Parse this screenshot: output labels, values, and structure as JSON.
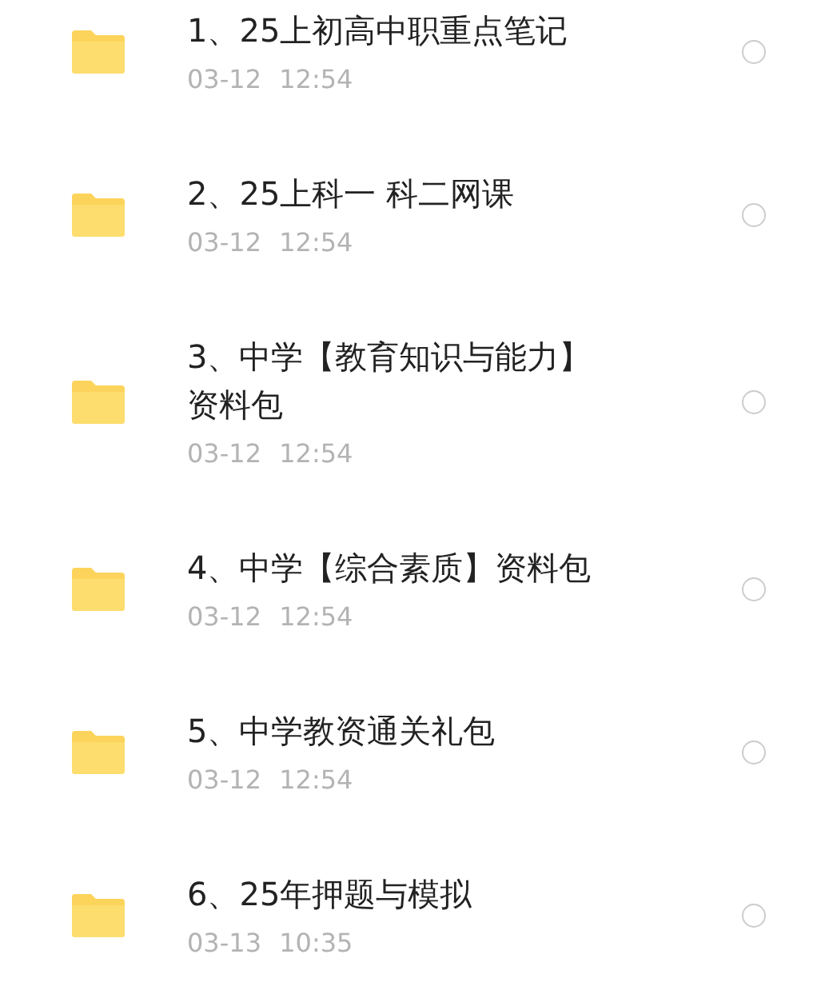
{
  "files": [
    {
      "name": "1、25上初高中职重点笔记",
      "time": "03-12 12:54",
      "selected": false
    },
    {
      "name": "2、25上科一 科二网课",
      "time": "03-12 12:54",
      "selected": false
    },
    {
      "name": "3、中学【教育知识与能力】资料包",
      "time": "03-12 12:54",
      "selected": false
    },
    {
      "name": "4、中学【综合素质】资料包",
      "time": "03-12 12:54",
      "selected": false
    },
    {
      "name": "5、中学教资通关礼包",
      "time": "03-12 12:54",
      "selected": false
    },
    {
      "name": "6、25年押题与模拟",
      "time": "03-13 10:35",
      "selected": false
    }
  ]
}
